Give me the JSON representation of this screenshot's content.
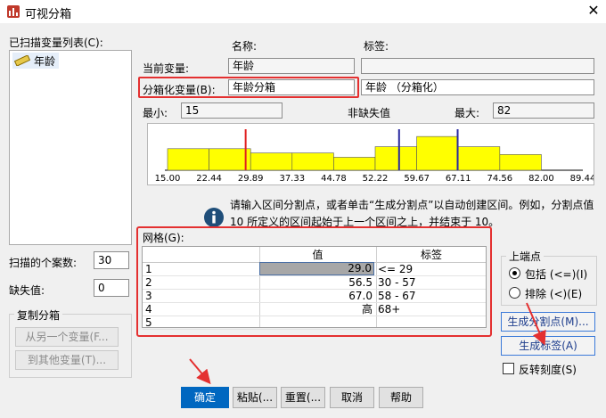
{
  "window": {
    "title": "可视分箱"
  },
  "scanned_list": {
    "label": "已扫描变量列表(C):",
    "items": [
      {
        "label": "年龄",
        "icon": "scale-ruler-icon"
      }
    ]
  },
  "headers": {
    "name": "名称:",
    "label": "标签:"
  },
  "current_var": {
    "label": "当前变量:",
    "name": "年龄",
    "var_label": ""
  },
  "binned_var": {
    "label": "分箱化变量(B):",
    "name": "年龄分箱",
    "var_label": "年龄 （分箱化）"
  },
  "stats": {
    "min_label": "最小:",
    "min_value": "15",
    "nonmissing_label": "非缺失值",
    "max_label": "最大:",
    "max_value": "82"
  },
  "chart_data": {
    "type": "bar",
    "x_ticks": [
      "15.00",
      "22.44",
      "29.89",
      "37.33",
      "44.78",
      "52.22",
      "59.67",
      "67.11",
      "74.56",
      "82.00",
      "89.44"
    ],
    "bins": [
      {
        "from": 15.0,
        "to": 22.44,
        "height": 0.55
      },
      {
        "from": 22.44,
        "to": 29.89,
        "height": 0.55
      },
      {
        "from": 29.89,
        "to": 37.33,
        "height": 0.44
      },
      {
        "from": 37.33,
        "to": 44.78,
        "height": 0.44
      },
      {
        "from": 44.78,
        "to": 52.22,
        "height": 0.33
      },
      {
        "from": 52.22,
        "to": 59.67,
        "height": 0.6
      },
      {
        "from": 59.67,
        "to": 67.11,
        "height": 0.86
      },
      {
        "from": 67.11,
        "to": 74.56,
        "height": 0.6
      },
      {
        "from": 74.56,
        "to": 82.0,
        "height": 0.4
      }
    ],
    "cutpoints": [
      {
        "value": 29.0,
        "color": "#e02020"
      },
      {
        "value": 56.5,
        "color": "#2a2aa0"
      },
      {
        "value": 67.0,
        "color": "#2a2aa0"
      }
    ],
    "xlim": [
      15.0,
      89.44
    ],
    "bar_color": "#ffff00"
  },
  "hint_text": "请输入区间分割点，或者单击“生成分割点”以自动创建区间。例如，分割点值 10 所定义的区间起始于上一个区间之上，并结束于 10。",
  "grid": {
    "label": "网格(G):",
    "columns": [
      "值",
      "标签"
    ],
    "rows": [
      {
        "num": "1",
        "value": "29.0",
        "label": "<= 29"
      },
      {
        "num": "2",
        "value": "56.5",
        "label": "30 - 57"
      },
      {
        "num": "3",
        "value": "67.0",
        "label": "58 - 67"
      },
      {
        "num": "4",
        "value": "高",
        "label": "68+"
      },
      {
        "num": "5",
        "value": "",
        "label": ""
      }
    ]
  },
  "cases": {
    "scanned_label": "扫描的个案数:",
    "scanned_value": "30",
    "missing_label": "缺失值:",
    "missing_value": "0"
  },
  "copy_bins": {
    "label": "复制分箱",
    "from_button": "从另一个变量(F...",
    "to_button": "到其他变量(T)..."
  },
  "upper_endpoint": {
    "label": "上端点",
    "include": "包括 (<=)(I)",
    "exclude": "排除 (<)(E)"
  },
  "side_buttons": {
    "make_cutpoints": "生成分割点(M)...",
    "make_labels": "生成标签(A)"
  },
  "reverse": {
    "label": "反转刻度(S)"
  },
  "footer": {
    "ok": "确定",
    "paste": "粘贴(...",
    "reset": "重置(...",
    "cancel": "取消",
    "help": "帮助"
  },
  "colors": {
    "accent": "#0067c0",
    "highlight_red": "#e43030",
    "bar_yellow": "#ffff00"
  }
}
